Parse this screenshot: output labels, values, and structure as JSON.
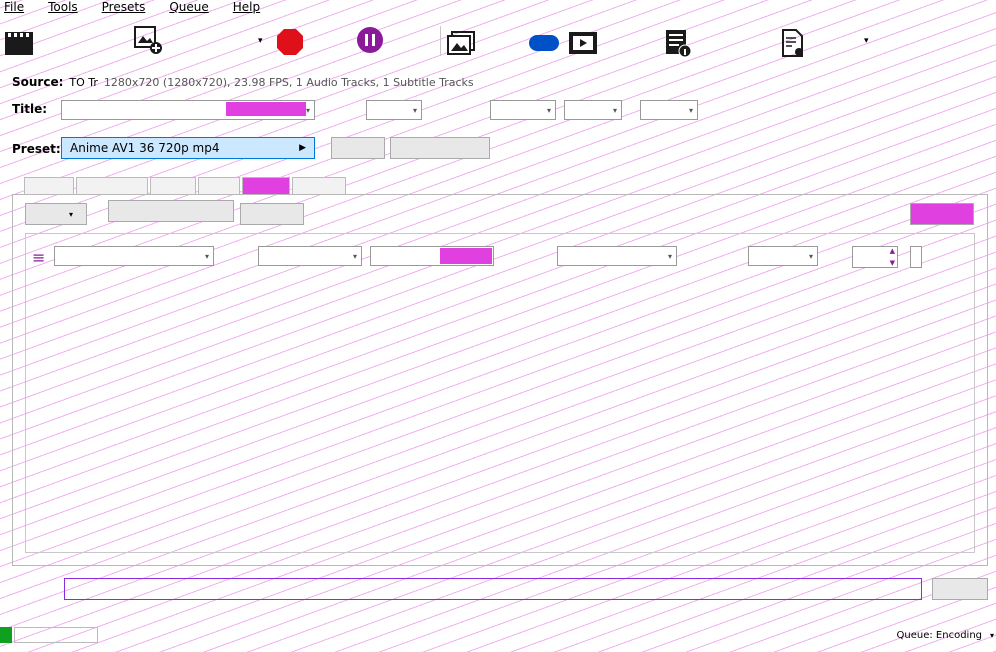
{
  "menu": {
    "file": "File",
    "tools": "Tools",
    "presets": "Presets",
    "queue": "Queue",
    "help": "Help"
  },
  "toolbar": {
    "colors": {
      "open_icon": "#1a1a1a",
      "stop": "#e0101a",
      "pause": "#8b1a9a",
      "toggle": "#0050c8",
      "accent": "#e040e0"
    }
  },
  "source": {
    "label": "Source:",
    "name": "TO Tr",
    "info": "1280x720 (1280x720), 23.98 FPS, 1 Audio Tracks, 1 Subtitle Tracks"
  },
  "title": {
    "label": "Title:"
  },
  "preset": {
    "label": "Preset:",
    "value": "Anime AV1 36 720p mp4"
  },
  "status": {
    "right": "Queue: Encoding"
  }
}
